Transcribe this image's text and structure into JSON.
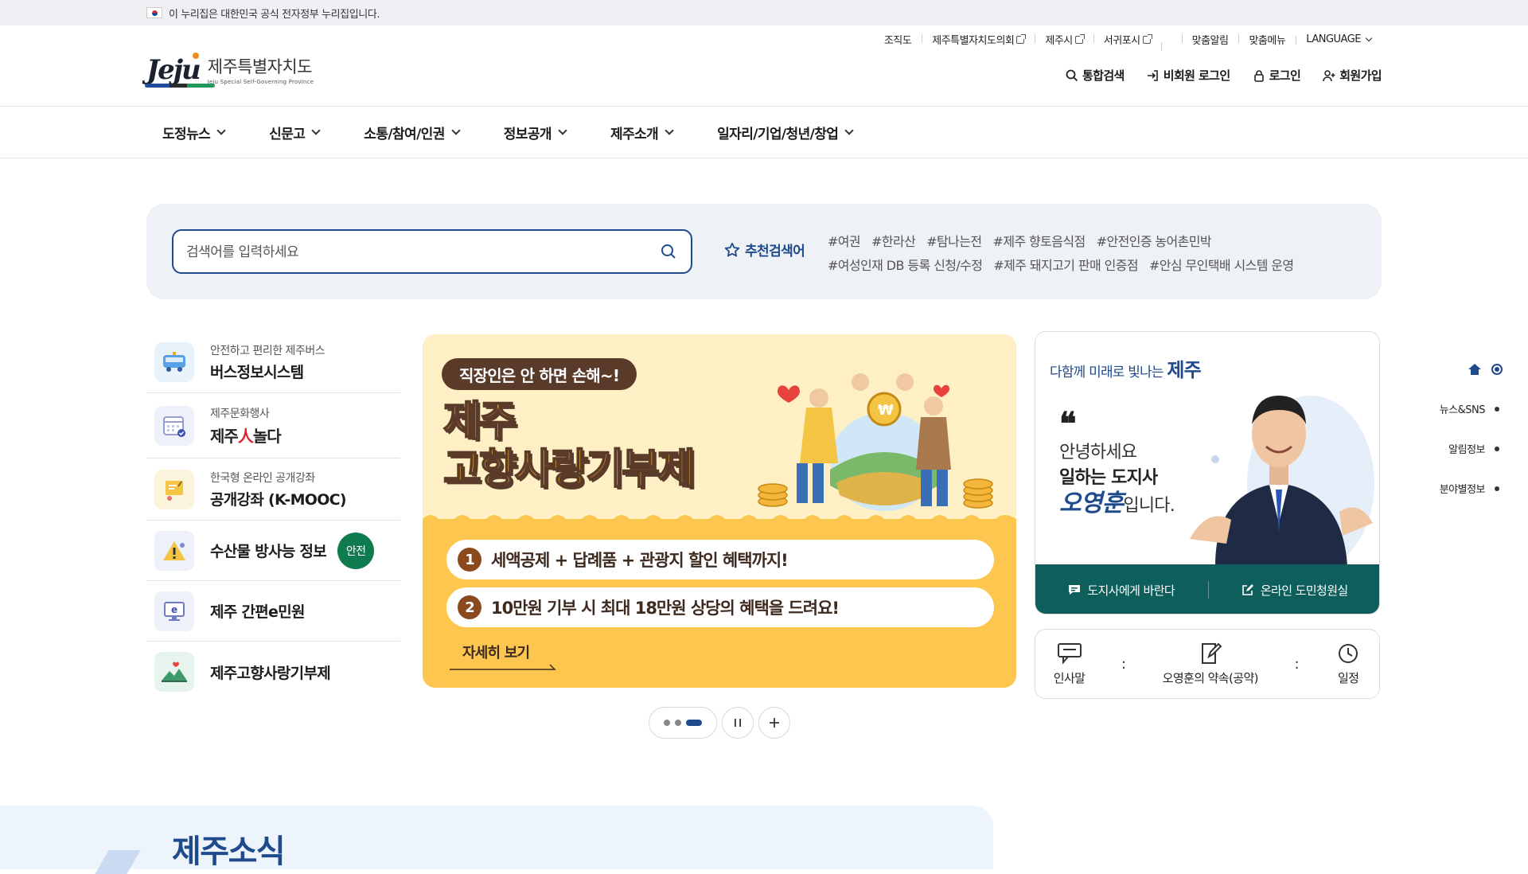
{
  "gov_banner": {
    "text": "이 누리집은 대한민국 공식 전자정부 누리집입니다."
  },
  "logo": {
    "mark": "Jeju",
    "name_ko": "제주특별자치도",
    "name_en": "Jeju Special Self-Governing Province"
  },
  "util_links": [
    {
      "label": "조직도",
      "external": false
    },
    {
      "label": "제주특별자치도의회",
      "external": true
    },
    {
      "label": "제주시",
      "external": true
    },
    {
      "label": "서귀포시",
      "external": true
    },
    {
      "label": "",
      "external": false
    },
    {
      "label": "맞춤알림",
      "external": false
    },
    {
      "label": "맞춤메뉴",
      "external": false
    }
  ],
  "language": {
    "label": "LANGUAGE"
  },
  "account": {
    "search": "통합검색",
    "guest_login": "비회원 로그인",
    "login": "로그인",
    "signup": "회원가입"
  },
  "gnb": [
    "도정뉴스",
    "신문고",
    "소통/참여/인권",
    "정보공개",
    "제주소개",
    "일자리/기업/청년/창업"
  ],
  "search": {
    "placeholder": "검색어를 입력하세요",
    "rec_label": "추천검색어",
    "tags": [
      "#여권",
      "#한라산",
      "#탐나는전",
      "#제주 향토음식점",
      "#안전인증 농어촌민박",
      "#여성인재 DB 등록 신청/수정",
      "#제주 돼지고기 판매 인증점",
      "#안심 무인택배 시스템 운영"
    ]
  },
  "quick_links": [
    {
      "sub": "안전하고 편리한 제주버스",
      "main": "버스정보시스템",
      "icon": "bus-icon"
    },
    {
      "sub": "제주문화행사",
      "main": "",
      "logo_a": "제주",
      "logo_b": "人",
      "logo_c": "놀다",
      "icon": "calendar-icon"
    },
    {
      "sub": "한국형 온라인 공개강좌",
      "main": "공개강좌 (K-MOOC)",
      "icon": "lecture-icon"
    },
    {
      "sub": "",
      "main": "수산물 방사능 정보",
      "badge": "안전",
      "icon": "warning-icon"
    },
    {
      "sub": "",
      "main": "제주 간편e민원",
      "icon": "monitor-icon"
    },
    {
      "sub": "",
      "main": "제주고향사랑기부제",
      "icon": "hometown-icon"
    }
  ],
  "banner": {
    "pill": "직장인은 안 하면 손해~!",
    "title_line1": "제주",
    "title_line2": "고향사랑기부제",
    "points": [
      {
        "num": "1",
        "text": "세액공제 + 답례품 + 관광지 할인 혜택까지!"
      },
      {
        "num": "2",
        "text": "10만원 기부 시 최대 18만원 상당의 혜택을 드려요!"
      }
    ],
    "more": "자세히 보기",
    "accent": "#fcc64f"
  },
  "pager": {
    "total": 3,
    "active": 3
  },
  "governor": {
    "slogan_pre": "다함께 미래로 빛나는",
    "slogan_jeju": "제주",
    "quote": "❝",
    "line1": "안녕하세요",
    "line2": "일하는 도지사",
    "name": "오영훈",
    "name_suffix": "입니다.",
    "actions": [
      "도지사에게 바란다",
      "온라인 도민청원실"
    ],
    "menu": [
      "인사말",
      "오영훈의 약속(공약)",
      "일정"
    ],
    "colon": ":"
  },
  "side_nav": [
    "뉴스&SNS",
    "알림정보",
    "분야별정보"
  ],
  "news_section": {
    "title": "제주소식"
  },
  "colors": {
    "primary": "#1f4a8b",
    "teal": "#0e5e5c",
    "safe_badge": "#0f7b4f"
  }
}
